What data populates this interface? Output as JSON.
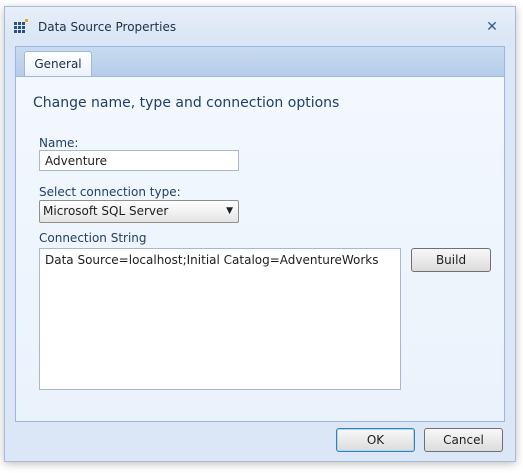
{
  "window": {
    "title": "Data Source Properties",
    "app_icon": "grid-app-icon",
    "close_icon": "close-icon"
  },
  "tabs": [
    {
      "label": "General",
      "selected": true
    }
  ],
  "form": {
    "heading": "Change name, type and connection options",
    "name_label": "Name:",
    "name_value": "Adventure",
    "connection_type_label": "Select connection type:",
    "connection_type_value": "Microsoft SQL Server",
    "connection_string_label": "Connection String",
    "connection_string_value": "Data Source=localhost;Initial Catalog=AdventureWorks",
    "build_label": "Build"
  },
  "footer": {
    "ok_label": "OK",
    "cancel_label": "Cancel"
  },
  "colors": {
    "window_bg": "#dbe7f6",
    "label_text": "#1e3f68",
    "accent_orange": "#f0a030"
  }
}
